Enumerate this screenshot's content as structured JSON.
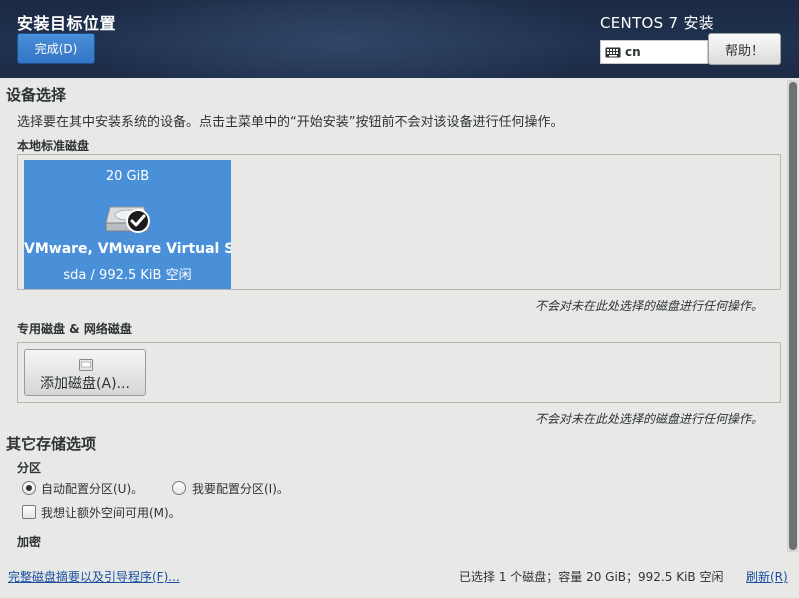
{
  "header": {
    "title": "安装目标位置",
    "done_label": "完成(D)",
    "product": "CENTOS 7 安装",
    "keyboard_layout": "cn",
    "help_label": "帮助！"
  },
  "device_selection": {
    "title": "设备选择",
    "description": "选择要在其中安装系统的设备。点击主菜单中的“开始安装”按钮前不会对该设备进行任何操作。",
    "local_disks_heading": "本地标准磁盘",
    "disks": [
      {
        "size": "20 GiB",
        "name": "VMware, VMware Virtual S",
        "device_free": "sda   /   992.5 KiB 空闲",
        "selected": true
      }
    ],
    "local_note": "不会对未在此处选择的磁盘进行任何操作。",
    "specialized_heading": "专用磁盘 & 网络磁盘",
    "add_disk_label": "添加磁盘(A)...",
    "specialized_note": "不会对未在此处选择的磁盘进行任何操作。"
  },
  "other_storage": {
    "title": "其它存储选项",
    "partition_heading": "分区",
    "auto_partition_label": "自动配置分区(U)。",
    "manual_partition_label": "我要配置分区(I)。",
    "auto_selected": true,
    "extra_space_label": "我想让额外空间可用(M)。",
    "extra_space_checked": false,
    "encryption_heading": "加密"
  },
  "footer": {
    "summary_link": "完整磁盘摘要以及引导程序(F)...",
    "status": "已选择 1 个磁盘；容量 20 GiB；992.5 KiB 空闲",
    "refresh_label": "刷新(R)"
  },
  "colors": {
    "header_bg": "#1e2f4c",
    "accent": "#4a90d9",
    "link": "#1a4fa0",
    "content_bg": "#e8e8e7"
  }
}
